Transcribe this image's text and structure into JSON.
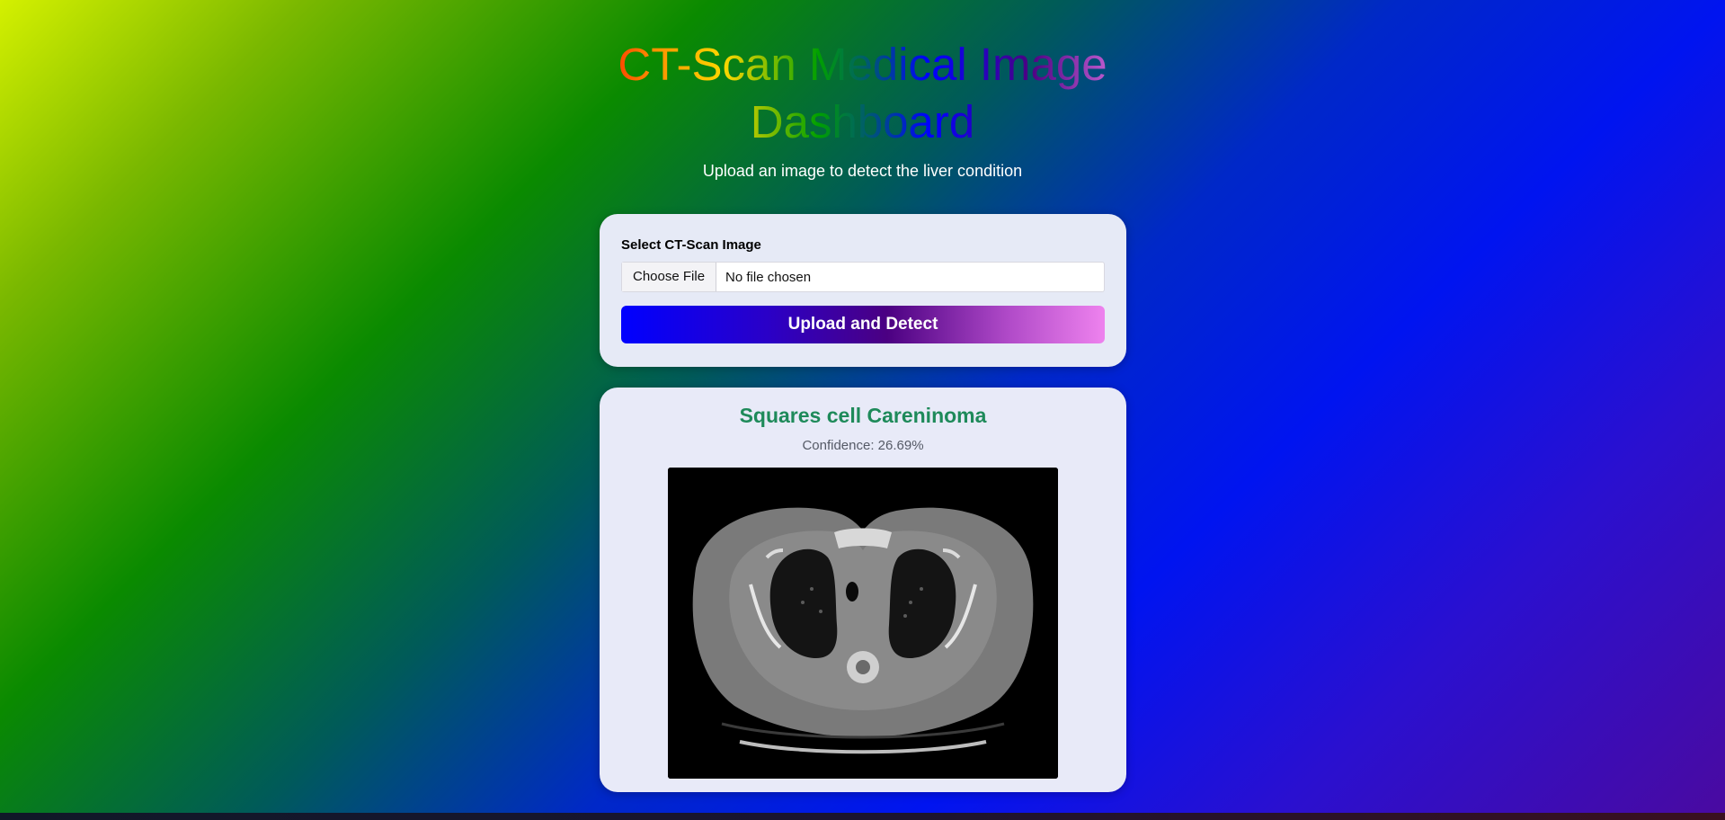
{
  "header": {
    "title": "CT-Scan Medical Image Dashboard",
    "subtitle": "Upload an image to detect the liver condition"
  },
  "upload_form": {
    "label": "Select CT-Scan Image",
    "choose_file_label": "Choose File",
    "file_status": "No file chosen",
    "submit_label": "Upload and Detect"
  },
  "result": {
    "prediction": "Squares cell Careninoma",
    "confidence": "Confidence: 26.69%"
  },
  "colors": {
    "prediction_text": "#1e8a5a",
    "button_gradient_start": "#0000ff",
    "button_gradient_end": "#ee82ee"
  }
}
